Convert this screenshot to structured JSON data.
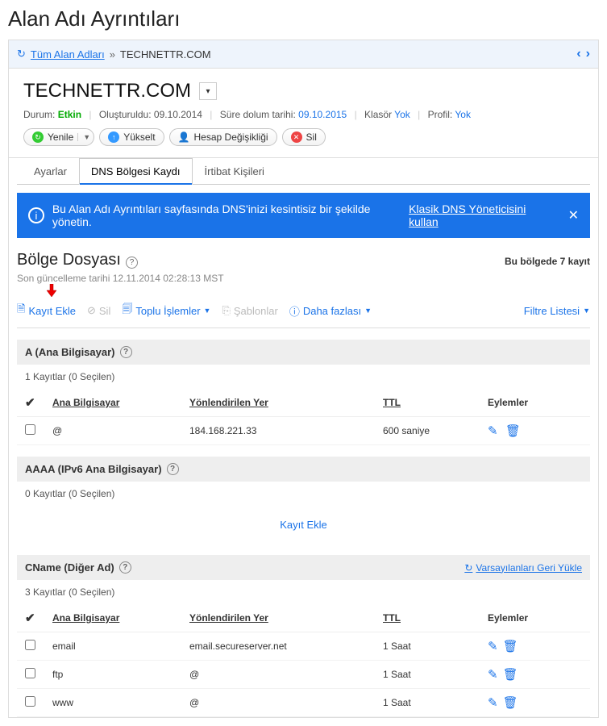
{
  "pageTitle": "Alan Adı Ayrıntıları",
  "breadcrumb": {
    "root": "Tüm Alan Adları",
    "current": "TECHNETTR.COM"
  },
  "domain": {
    "name": "TECHNETTR.COM",
    "statusLabel": "Durum:",
    "statusValue": "Etkin",
    "createdLabel": "Oluşturuldu:",
    "createdValue": "09.10.2014",
    "expiresLabel": "Süre dolum tarihi:",
    "expiresValue": "09.10.2015",
    "folderLabel": "Klasör",
    "folderValue": "Yok",
    "profileLabel": "Profil:",
    "profileValue": "Yok"
  },
  "actions": {
    "refresh": "Yenile",
    "upgrade": "Yükselt",
    "accountChange": "Hesap Değişikliği",
    "delete": "Sil"
  },
  "tabs": {
    "settings": "Ayarlar",
    "dns": "DNS Bölgesi Kaydı",
    "contacts": "İrtibat Kişileri"
  },
  "banner": {
    "text": "Bu Alan Adı Ayrıntıları sayfasında DNS'inizi kesintisiz bir şekilde yönetin.",
    "link": "Klasik DNS Yöneticisini kullan"
  },
  "zone": {
    "title": "Bölge Dosyası",
    "rightMeta": "Bu bölgede 7 kayıt",
    "updated": "Son güncelleme tarihi 12.11.2014 02:28:13 MST"
  },
  "toolbar": {
    "addRecord": "Kayıt Ekle",
    "delete": "Sil",
    "bulk": "Toplu İşlemler",
    "templates": "Şablonlar",
    "more": "Daha fazlası",
    "filter": "Filtre Listesi"
  },
  "headers": {
    "host": "Ana Bilgisayar",
    "target": "Yönlendirilen Yer",
    "ttl": "TTL",
    "actions": "Eylemler"
  },
  "groups": {
    "a": {
      "title": "A (Ana Bilgisayar)",
      "count": "1 Kayıtlar (0 Seçilen)",
      "rows": [
        {
          "host": "@",
          "target": "184.168.221.33",
          "ttl": "600 saniye"
        }
      ]
    },
    "aaaa": {
      "title": "AAAA (IPv6 Ana Bilgisayar)",
      "count": "0 Kayıtlar (0 Seçilen)",
      "addLink": "Kayıt Ekle"
    },
    "cname": {
      "title": "CName (Diğer Ad)",
      "count": "3 Kayıtlar (0 Seçilen)",
      "restore": "Varsayılanları Geri Yükle",
      "rows": [
        {
          "host": "email",
          "target": "email.secureserver.net",
          "ttl": "1 Saat"
        },
        {
          "host": "ftp",
          "target": "@",
          "ttl": "1 Saat"
        },
        {
          "host": "www",
          "target": "@",
          "ttl": "1 Saat"
        }
      ]
    }
  }
}
